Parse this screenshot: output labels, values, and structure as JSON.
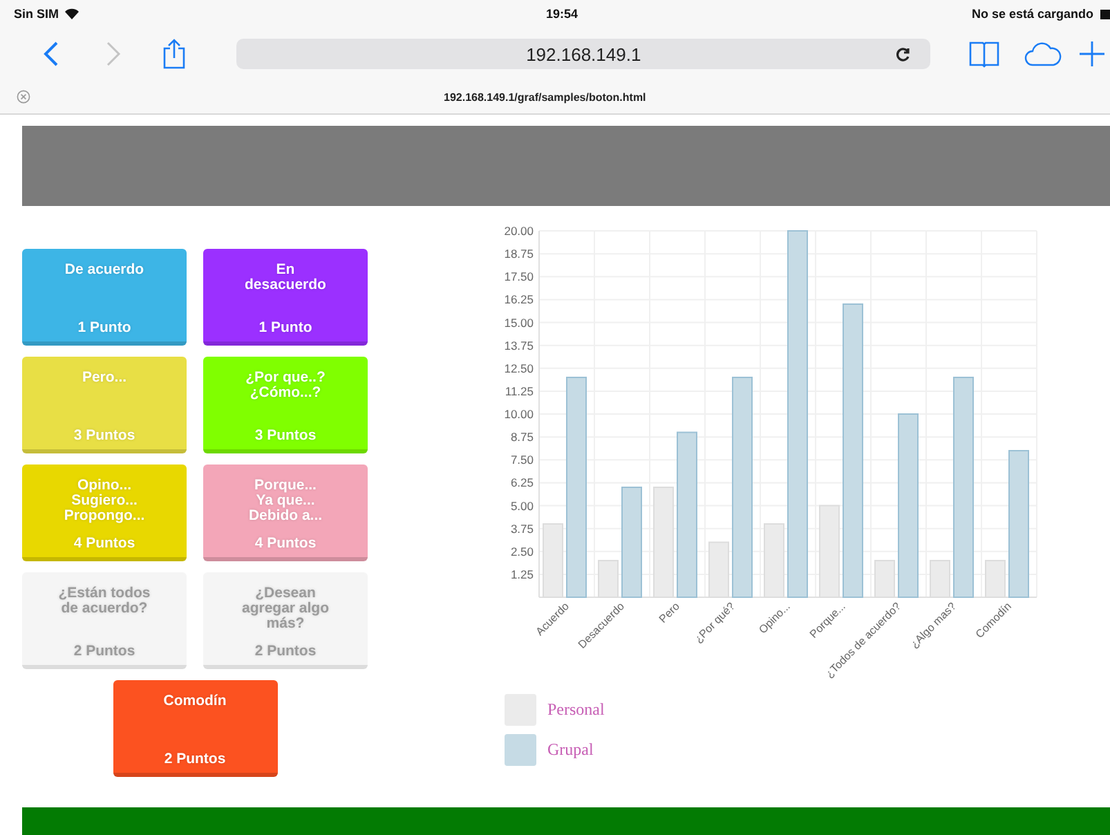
{
  "status_bar": {
    "carrier": "Sin SIM",
    "time": "19:54",
    "battery_text": "No se está cargando"
  },
  "browser": {
    "address": "192.168.149.1",
    "page_url": "192.168.149.1/graf/samples/boton.html",
    "forward_disabled": true
  },
  "buttons": [
    {
      "label": "De acuerdo",
      "points": "1 Punto",
      "color": "#3db5e6",
      "kind": "solid"
    },
    {
      "label": "En\ndesacuerdo",
      "points": "1 Punto",
      "color": "#9b30ff",
      "kind": "solid"
    },
    {
      "label": "Pero...",
      "points": "3 Puntos",
      "color": "#e8df45",
      "kind": "solid"
    },
    {
      "label": "¿Por que..?\n¿Cómo...?",
      "points": "3 Puntos",
      "color": "#80ff00",
      "kind": "solid"
    },
    {
      "label": "Opino...\nSugiero...\nPropongo...",
      "points": "4 Puntos",
      "color": "#e8d800",
      "kind": "solid"
    },
    {
      "label": "Porque...\nYa que...\nDebido a...",
      "points": "4 Puntos",
      "color": "#f3a6b8",
      "kind": "solid"
    },
    {
      "label": "¿Están todos\nde acuerdo?",
      "points": "2 Puntos",
      "color": "#f5f5f5",
      "kind": "muted"
    },
    {
      "label": "¿Desean\nagregar algo\nmás?",
      "points": "2 Puntos",
      "color": "#f5f5f5",
      "kind": "muted"
    },
    {
      "label": "Comodín",
      "points": "2 Puntos",
      "color": "#fc5220",
      "kind": "solid"
    }
  ],
  "chart": {
    "chart_data": {
      "type": "bar",
      "categories": [
        "Acuerdo",
        "Desacuerdo",
        "Pero",
        "¿Por qué?",
        "Opino...",
        "Porque...",
        "¿Todos de acuerdo?",
        "¿Algo mas?",
        "Comodín"
      ],
      "series": [
        {
          "name": "Personal",
          "color": "#ebebeb",
          "values": [
            4,
            2,
            6,
            3,
            4,
            5,
            2,
            2,
            2
          ]
        },
        {
          "name": "Grupal",
          "color": "#c6dbe5",
          "values": [
            12,
            6,
            9,
            12,
            20,
            16,
            10,
            12,
            8
          ]
        }
      ],
      "ylim": [
        0,
        20
      ],
      "grid": true,
      "legend": "bottom",
      "yticks": [
        {
          "value": 1.25,
          "label": "1.25"
        },
        {
          "value": 2.5,
          "label": "2.50"
        },
        {
          "value": 3.75,
          "label": "3.75"
        },
        {
          "value": 5,
          "label": "5.00"
        },
        {
          "value": 6.25,
          "label": "6.25"
        },
        {
          "value": 7.5,
          "label": "7.50"
        },
        {
          "value": 8.75,
          "label": "8.75"
        },
        {
          "value": 10,
          "label": "10.00"
        },
        {
          "value": 11.25,
          "label": "11.25"
        },
        {
          "value": 12.5,
          "label": "12.50"
        },
        {
          "value": 13.75,
          "label": "13.75"
        },
        {
          "value": 15,
          "label": "15.00"
        },
        {
          "value": 16.25,
          "label": "16.25"
        },
        {
          "value": 17.5,
          "label": "17.50"
        },
        {
          "value": 18.75,
          "label": "18.75"
        },
        {
          "value": 20,
          "label": "20.00"
        }
      ]
    }
  }
}
